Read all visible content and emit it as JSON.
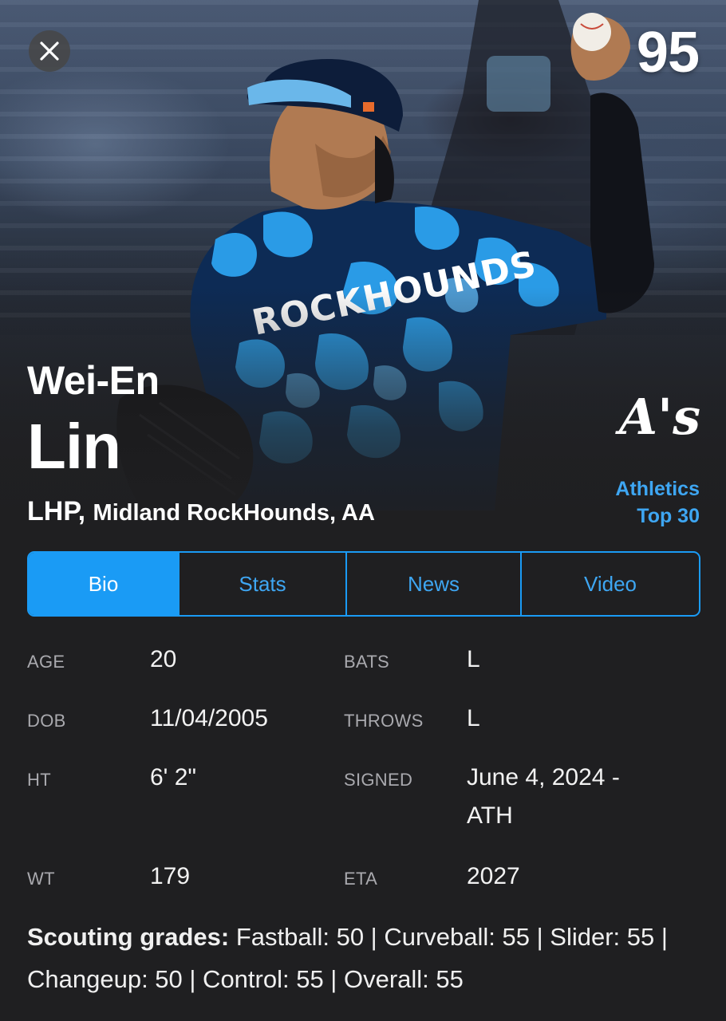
{
  "header": {
    "rating": "95",
    "first_name": "Wei-En",
    "last_name": "Lin",
    "position": "LHP",
    "team_level": "Midland RockHounds, AA",
    "org_logo_text": "A's",
    "org_rank_line1": "Athletics",
    "org_rank_line2": "Top 30",
    "jersey_text": "ROCKHOUNDS"
  },
  "tabs": [
    {
      "label": "Bio",
      "active": true
    },
    {
      "label": "Stats",
      "active": false
    },
    {
      "label": "News",
      "active": false
    },
    {
      "label": "Video",
      "active": false
    }
  ],
  "bio": {
    "left": [
      {
        "label": "AGE",
        "value": "20"
      },
      {
        "label": "DOB",
        "value": "11/04/2005"
      },
      {
        "label": "HT",
        "value": "6' 2\""
      },
      {
        "label": "WT",
        "value": "179"
      }
    ],
    "right": [
      {
        "label": "BATS",
        "value": "L"
      },
      {
        "label": "THROWS",
        "value": "L"
      },
      {
        "label": "SIGNED",
        "value_line1": "June 4, 2024 -",
        "value_line2": "ATH"
      },
      {
        "label": "ETA",
        "value": "2027"
      }
    ]
  },
  "scouting": {
    "label": "Scouting grades:",
    "text": " Fastball: 50 | Curveball: 55 | Slider: 55 | Changeup: 50 | Control: 55 | Overall: 55"
  },
  "colors": {
    "accent": "#1a9bf5",
    "accent_text": "#3ea6f2",
    "background": "#1f1f21",
    "label_gray": "#a9a9ae"
  },
  "icons": {
    "close": "close-icon",
    "team_logo": "athletics-logo"
  }
}
